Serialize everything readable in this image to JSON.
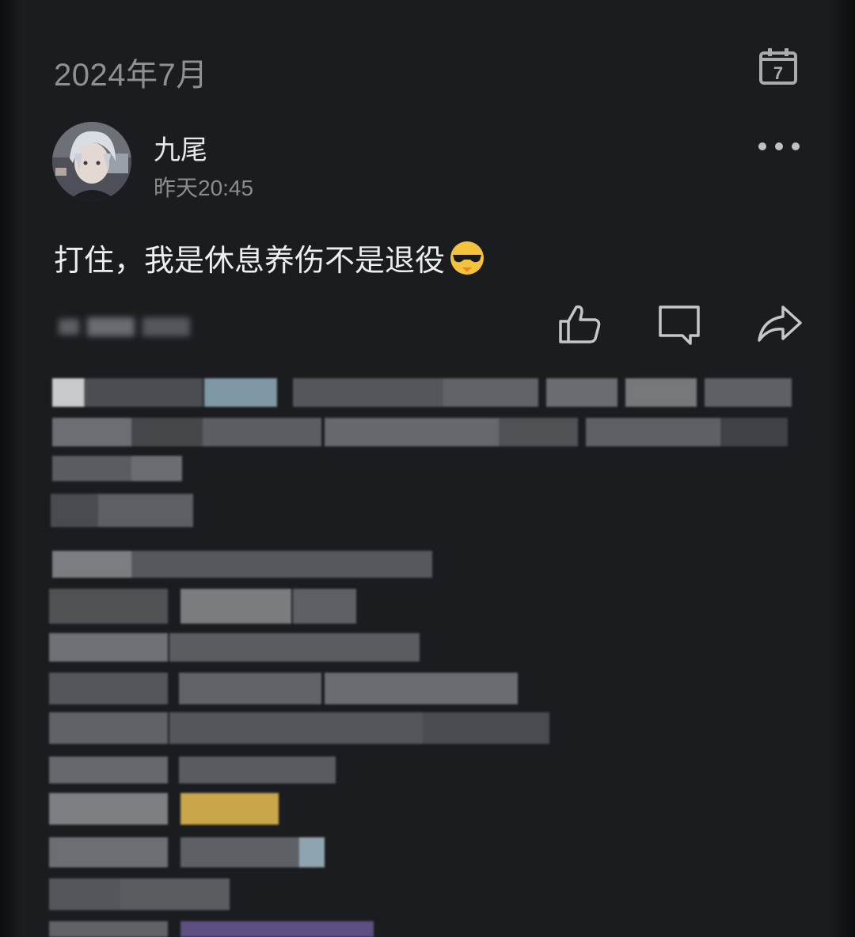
{
  "header": {
    "month_label": "2024年7月",
    "calendar_icon_day": "7"
  },
  "post": {
    "author": "九尾",
    "time": "昨天20:45",
    "text": "打住，我是休息养伤不是退役",
    "emoji": "sunglasses-face-emoji"
  },
  "actions": {
    "like_icon": "thumbs-up-icon",
    "comment_icon": "comment-icon",
    "share_icon": "share-icon",
    "more_icon": "more-dots-icon"
  },
  "colors": {
    "background": "#1b1c1f",
    "text_primary": "#e6e7e9",
    "text_secondary": "#8a8c90",
    "icon": "#c4c6ca"
  }
}
